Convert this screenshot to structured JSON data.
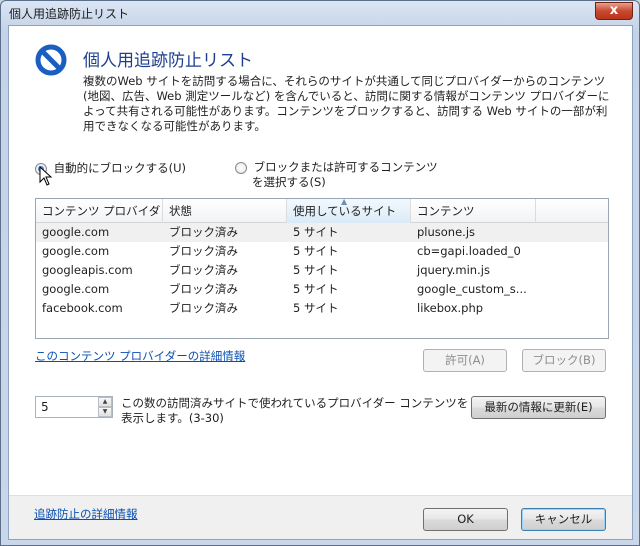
{
  "window": {
    "title": "個人用追跡防止リスト",
    "close_glyph": "x"
  },
  "header": {
    "title": "個人用追跡防止リスト",
    "description": "複数のWeb サイトを訪問する場合に、それらのサイトが共通して同じプロバイダーからのコンテンツ (地図、広告、Web 測定ツールなど) を含んでいると、訪問に関する情報がコンテンツ プロバイダーによって共有される可能性があります。コンテンツをブロックすると、訪問する Web サイトの一部が利用できなくなる可能性があります。"
  },
  "options": {
    "auto_block": {
      "label": "自動的にブロックする(U)",
      "checked": true
    },
    "choose": {
      "label_line1": "ブロックまたは許可するコンテンツ",
      "label_line2": "を選択する(S)",
      "checked": false
    }
  },
  "table": {
    "columns": [
      "コンテンツ プロバイダー",
      "状態",
      "使用しているサイト",
      "コンテンツ"
    ],
    "rows": [
      [
        "google.com",
        "ブロック済み",
        "5 サイト",
        "plusone.js"
      ],
      [
        "google.com",
        "ブロック済み",
        "5 サイト",
        "cb=gapi.loaded_0"
      ],
      [
        "googleapis.com",
        "ブロック済み",
        "5 サイト",
        "jquery.min.js"
      ],
      [
        "google.com",
        "ブロック済み",
        "5 サイト",
        "google_custom_s..."
      ],
      [
        "facebook.com",
        "ブロック済み",
        "5 サイト",
        "likebox.php"
      ]
    ]
  },
  "provider_link": "このコンテンツ プロバイダーの詳細情報",
  "buttons": {
    "allow": "許可(A)",
    "block": "ブロック(B)",
    "refresh": "最新の情報に更新(E)",
    "ok": "OK",
    "cancel": "キャンセル"
  },
  "threshold": {
    "value": "5",
    "label": "この数の訪問済みサイトで使われているプロバイダー コンテンツを表示します。(3-30)"
  },
  "footer_link": "追跡防止の詳細情報",
  "colors": {
    "heading": "#1e3f8f",
    "link": "#0a4fb0",
    "block_icon": "#1a5fc0"
  }
}
